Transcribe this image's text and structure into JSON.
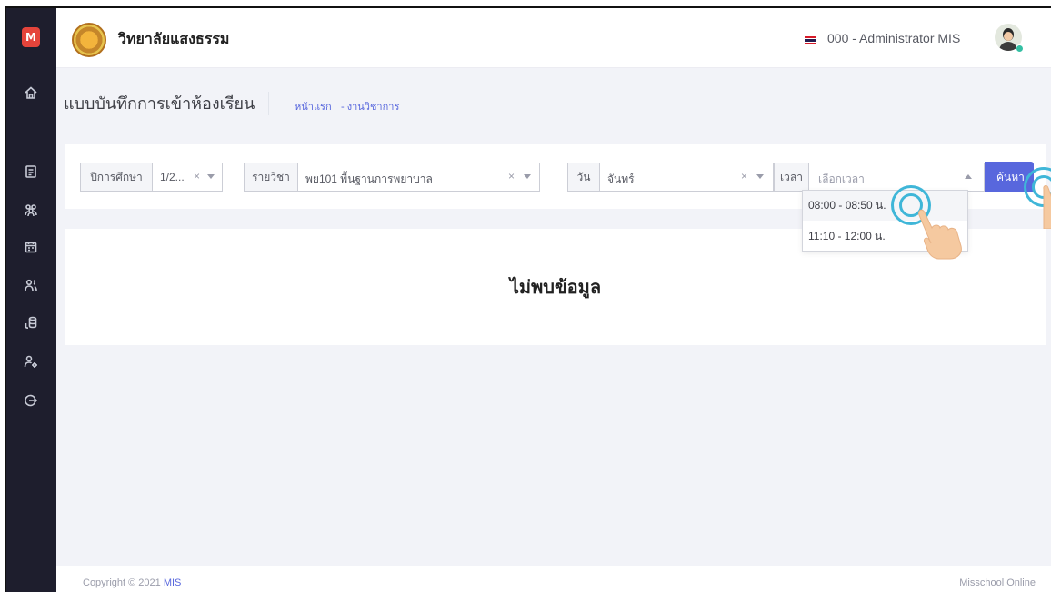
{
  "app": {
    "logo_letter": "M",
    "brand_name": "วิทยาลัยแสงธรรม",
    "user_name": "000 - Administrator MIS"
  },
  "sidebar": {
    "items": [
      {
        "icon": "home-icon"
      },
      {
        "icon": "document-icon"
      },
      {
        "icon": "users-icon"
      },
      {
        "icon": "calendar-icon"
      },
      {
        "icon": "user-group-icon"
      },
      {
        "icon": "coins-icon"
      },
      {
        "icon": "user-settings-icon"
      },
      {
        "icon": "logout-icon"
      }
    ]
  },
  "page": {
    "title": "แบบบันทึกการเข้าห้องเรียน",
    "breadcrumb": [
      "หน้าแรก",
      "- งานวิชาการ"
    ]
  },
  "filters": {
    "year_label": "ปีการศึกษา",
    "year_value": "1/2...",
    "subject_label": "รายวิชา",
    "subject_value": "พย101 พื้นฐานการพยาบาล",
    "day_label": "วัน",
    "day_value": "จันทร์",
    "time_label": "เวลา",
    "time_placeholder": "เลือกเวลา",
    "clear_symbol": "×",
    "search_label": "ค้นหา"
  },
  "time_options": [
    "08:00 - 08:50 น.",
    "11:10 - 12:00 น."
  ],
  "content": {
    "empty_message": "ไม่พบข้อมูล"
  },
  "footer": {
    "copyright_prefix": "Copyright © 2021",
    "copyright_brand": "MIS",
    "right_text": "Misschool Online"
  },
  "colors": {
    "sidebar": "#1e1e2d",
    "accent": "#5867dd",
    "logo": "#e5443b",
    "tap_indicator": "#3fb6d8"
  }
}
